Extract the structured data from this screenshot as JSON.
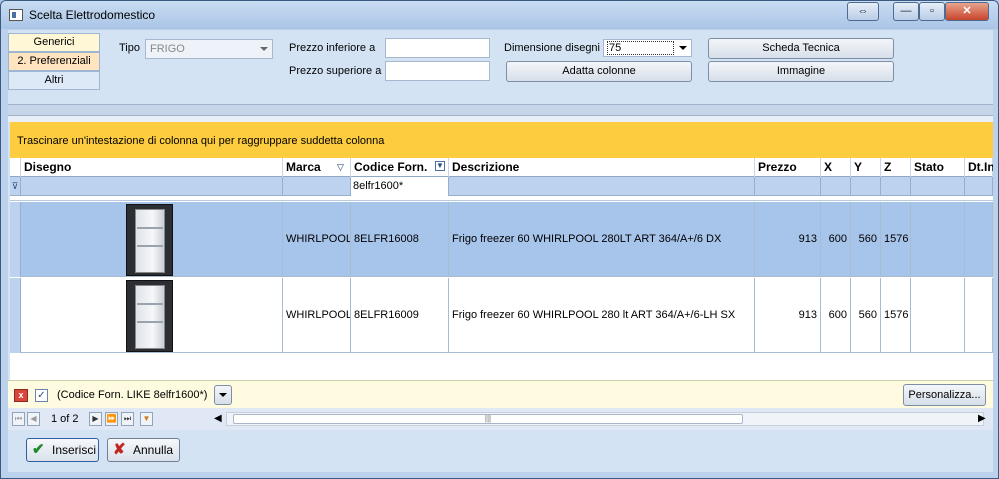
{
  "window": {
    "title": "Scelta Elettrodomestico",
    "restore_label": "⇔",
    "min_label": "—",
    "max_label": "▫",
    "close_label": "✕"
  },
  "tabs": [
    {
      "label": "Generici"
    },
    {
      "label": "2. Preferenziali"
    },
    {
      "label": "Altri"
    }
  ],
  "filters": {
    "tipo_label": "Tipo",
    "tipo_value": "FRIGO",
    "prezzo_inf_label": "Prezzo inferiore a",
    "prezzo_inf_value": "",
    "prezzo_sup_label": "Prezzo superiore a",
    "prezzo_sup_value": "",
    "dim_label": "Dimensione disegni",
    "dim_value": "75"
  },
  "buttons": {
    "scheda": "Scheda Tecnica",
    "adatta": "Adatta colonne",
    "immagine": "Immagine"
  },
  "grid": {
    "group_hint": "Trascinare un'intestazione di colonna qui per raggruppare suddetta colonna",
    "columns": [
      "Disegno",
      "Marca",
      "Codice Forn.",
      "Descrizione",
      "Prezzo",
      "X",
      "Y",
      "Z",
      "Stato",
      "Dt.In"
    ],
    "filter_value": "8elfr1600*",
    "rows": [
      {
        "marca": "WHIRLPOOL",
        "codice": "8ELFR16008",
        "descrizione": "Frigo freezer 60 WHIRLPOOL 280LT ART 364/A+/6 DX",
        "prezzo": "913",
        "x": "600",
        "y": "560",
        "z": "1576"
      },
      {
        "marca": "WHIRLPOOL",
        "codice": "8ELFR16009",
        "descrizione": "Frigo freezer 60 WHIRLPOOL 280 lt ART 364/A+/6-LH SX",
        "prezzo": "913",
        "x": "600",
        "y": "560",
        "z": "1576"
      }
    ]
  },
  "filterbar": {
    "expression": "(Codice Forn. LIKE 8elfr1600*)",
    "personalizza": "Personalizza..."
  },
  "pager": {
    "text": "1 of 2"
  },
  "actions": {
    "inserisci": "Inserisci",
    "annulla": "Annulla"
  }
}
